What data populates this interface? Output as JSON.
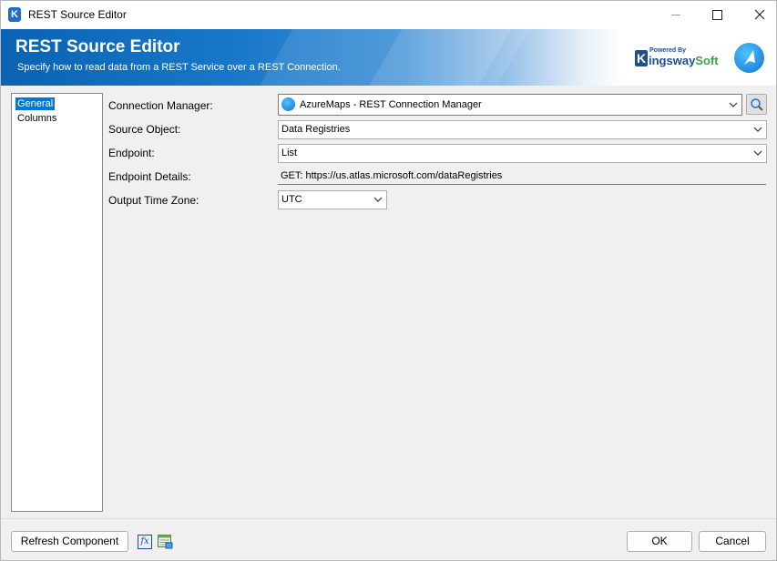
{
  "window": {
    "title": "REST Source Editor"
  },
  "header": {
    "title": "REST Source Editor",
    "subtitle": "Specify how to read data from a REST Service over a REST Connection.",
    "brand_powered": "Powered By",
    "brand_name_main": "ingsway",
    "brand_name_accent": "Soft",
    "brand_k": "K"
  },
  "nav": {
    "items": [
      {
        "label": "General",
        "selected": true
      },
      {
        "label": "Columns",
        "selected": false
      }
    ]
  },
  "form": {
    "connection_manager": {
      "label": "Connection Manager:",
      "value": "AzureMaps - REST Connection Manager"
    },
    "source_object": {
      "label": "Source Object:",
      "value": "Data Registries"
    },
    "endpoint": {
      "label": "Endpoint:",
      "value": "List"
    },
    "endpoint_details": {
      "label": "Endpoint Details:",
      "value": "GET: https://us.atlas.microsoft.com/dataRegistries"
    },
    "output_time_zone": {
      "label": "Output Time Zone:",
      "value": "UTC"
    }
  },
  "footer": {
    "refresh_label": "Refresh Component",
    "ok_label": "OK",
    "cancel_label": "Cancel"
  },
  "icons": {
    "app": "kingswaysoft-app-icon",
    "brand_badge": "azure-maps-icon",
    "search": "search-icon",
    "expression": "fx-expression-icon",
    "table": "table-icon"
  },
  "colors": {
    "banner_start": "#0a63b3",
    "selection": "#0078d7",
    "brand_blue": "#1f4e8c",
    "brand_green": "#38a349"
  }
}
